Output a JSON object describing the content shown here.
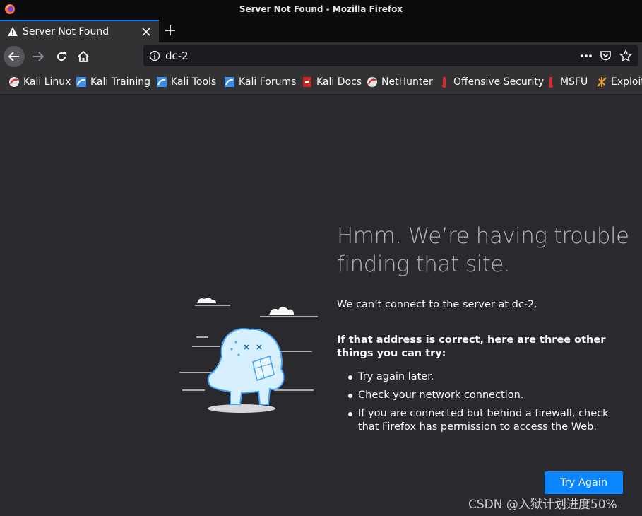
{
  "window": {
    "title": "Server Not Found - Mozilla Firefox"
  },
  "tab": {
    "title": "Server Not Found",
    "active": true
  },
  "navbar": {
    "url": "dc-2"
  },
  "bookmarks": [
    {
      "label": "Kali Linux",
      "icon": "kali-icon"
    },
    {
      "label": "Kali Training",
      "icon": "kali-training-icon"
    },
    {
      "label": "Kali Tools",
      "icon": "kali-tools-icon"
    },
    {
      "label": "Kali Forums",
      "icon": "kali-forums-icon"
    },
    {
      "label": "Kali Docs",
      "icon": "kali-docs-icon"
    },
    {
      "label": "NetHunter",
      "icon": "nethunter-icon"
    },
    {
      "label": "Offensive Security",
      "icon": "offsec-icon"
    },
    {
      "label": "MSFU",
      "icon": "msfu-icon"
    },
    {
      "label": "Exploit",
      "icon": "exploit-icon"
    }
  ],
  "error": {
    "heading": "Hmm. We’re having trouble finding that site.",
    "lead": "We can’t connect to the server at dc-2.",
    "subheading": "If that address is correct, here are three other things you can try:",
    "tips": [
      "Try again later.",
      "Check your network connection.",
      "If you are connected but behind a firewall, check that Firefox has permission to access the Web."
    ],
    "button": "Try Again"
  },
  "watermark": "CSDN @入狱计划进度50%",
  "colors": {
    "accent": "#0a84ff",
    "background": "#2a2a2e",
    "toolbar": "#323234",
    "titlebar": "#0c0c0d"
  }
}
